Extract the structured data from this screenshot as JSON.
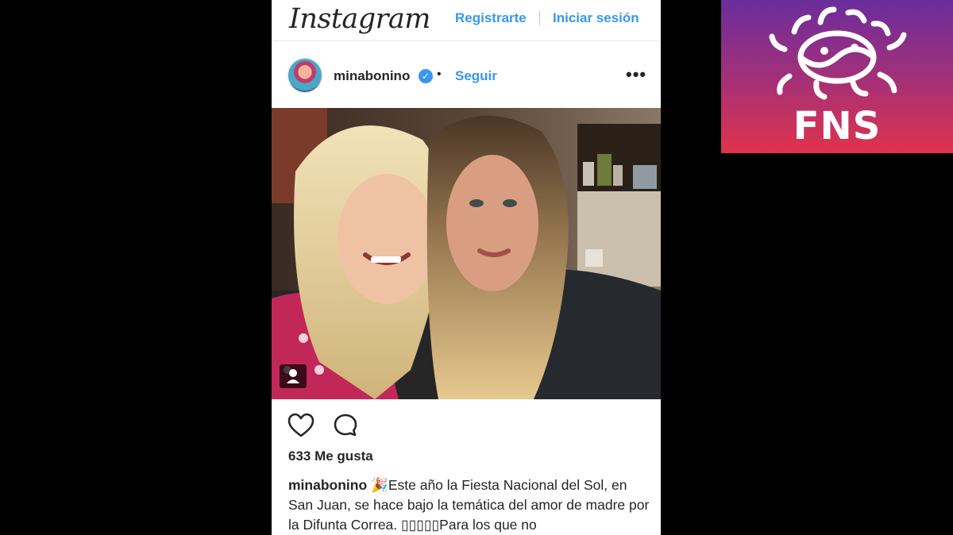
{
  "header": {
    "logo": "Instagram",
    "register_label": "Registrarte",
    "login_label": "Iniciar sesión"
  },
  "post": {
    "username": "minabonino",
    "follow_label": "Seguir",
    "likes_text": "633 Me gusta",
    "caption_emoji": "🎉",
    "caption_text": "Este año la Fiesta Nacional del Sol, en San Juan, se hace bajo la temática del amor de madre por la Difunta Correa. ▯▯▯▯▯Para los que no"
  },
  "logo_overlay": {
    "text": "FNS"
  },
  "icons": {
    "verified": "verified-badge-icon",
    "more": "more-options-icon",
    "like": "heart-icon",
    "comment": "comment-icon",
    "tag": "user-tag-icon"
  },
  "colors": {
    "link_blue": "#3897f0",
    "text": "#262626",
    "fns_gradient_top": "#6b2d9c",
    "fns_gradient_bottom": "#e0334c"
  }
}
